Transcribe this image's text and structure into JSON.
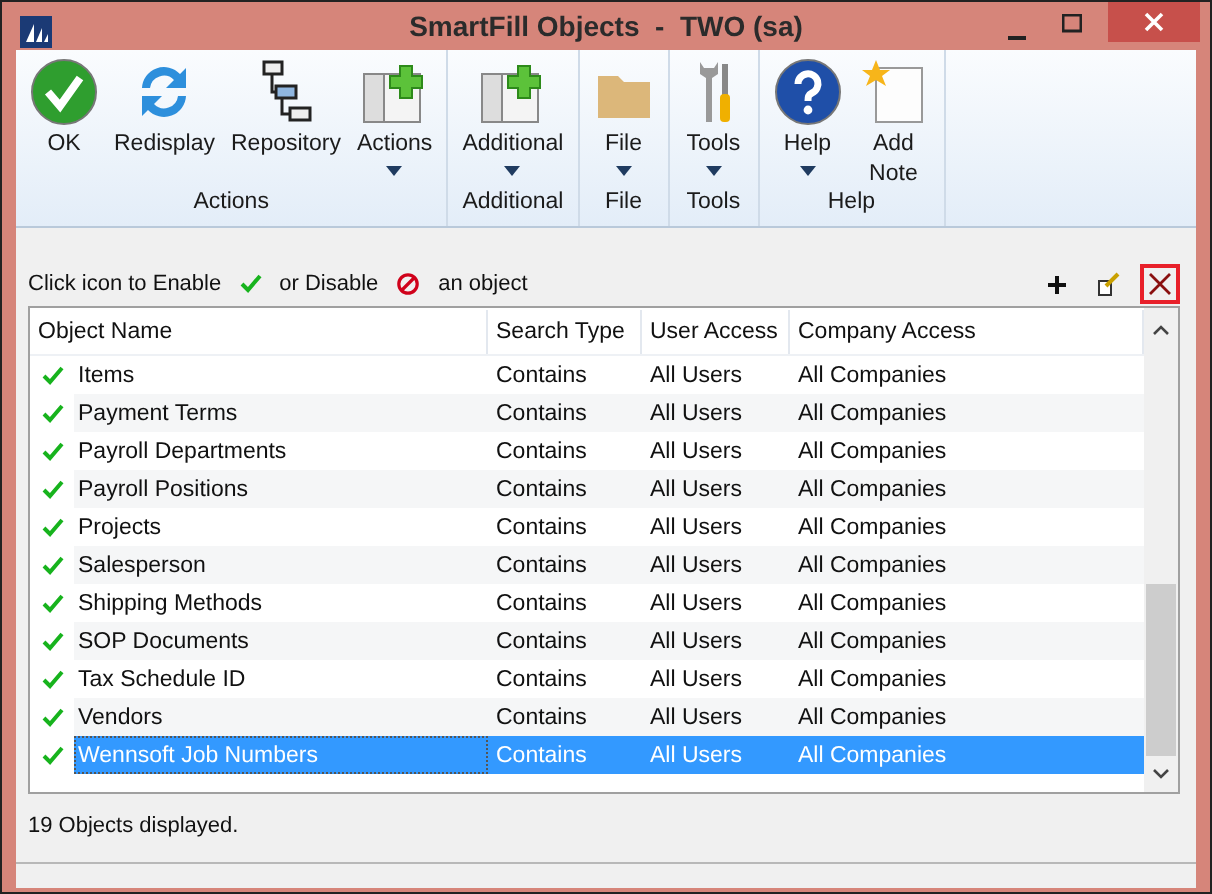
{
  "window": {
    "title": "SmartFill Objects  -  TWO (sa)"
  },
  "ribbon": {
    "groups": [
      {
        "label": "Actions",
        "buttons": [
          {
            "label": "OK",
            "kind": "ok",
            "dropdown": false
          },
          {
            "label": "Redisplay",
            "kind": "refresh",
            "dropdown": false
          },
          {
            "label": "Repository",
            "kind": "tree",
            "dropdown": false
          },
          {
            "label": "Actions",
            "kind": "window",
            "dropdown": true
          }
        ]
      },
      {
        "label": "Additional",
        "buttons": [
          {
            "label": "Additional",
            "kind": "window",
            "dropdown": true
          }
        ]
      },
      {
        "label": "File",
        "buttons": [
          {
            "label": "File",
            "kind": "folder",
            "dropdown": true
          }
        ]
      },
      {
        "label": "Tools",
        "buttons": [
          {
            "label": "Tools",
            "kind": "tools",
            "dropdown": true
          }
        ]
      },
      {
        "label": "Help",
        "buttons": [
          {
            "label": "Help",
            "kind": "help",
            "dropdown": true
          },
          {
            "label": "Add Note",
            "kind": "note",
            "dropdown": false
          }
        ]
      }
    ]
  },
  "hint": {
    "part_1": "Click icon to Enable",
    "part_2": "or Disable",
    "part_3": "an object"
  },
  "tools": [
    {
      "kind": "add",
      "highlighted": false
    },
    {
      "kind": "edit",
      "highlighted": false
    },
    {
      "kind": "delete",
      "highlighted": true
    }
  ],
  "table": {
    "columns": [
      "Object Name",
      "Search Type",
      "User Access",
      "Company Access"
    ],
    "rows": [
      {
        "name": "Items",
        "search_type": "Contains",
        "user_access": "All Users",
        "company_access": "All Companies",
        "enabled": true,
        "selected": false
      },
      {
        "name": "Payment Terms",
        "search_type": "Contains",
        "user_access": "All Users",
        "company_access": "All Companies",
        "enabled": true,
        "selected": false
      },
      {
        "name": "Payroll Departments",
        "search_type": "Contains",
        "user_access": "All Users",
        "company_access": "All Companies",
        "enabled": true,
        "selected": false
      },
      {
        "name": "Payroll Positions",
        "search_type": "Contains",
        "user_access": "All Users",
        "company_access": "All Companies",
        "enabled": true,
        "selected": false
      },
      {
        "name": "Projects",
        "search_type": "Contains",
        "user_access": "All Users",
        "company_access": "All Companies",
        "enabled": true,
        "selected": false
      },
      {
        "name": "Salesperson",
        "search_type": "Contains",
        "user_access": "All Users",
        "company_access": "All Companies",
        "enabled": true,
        "selected": false
      },
      {
        "name": "Shipping Methods",
        "search_type": "Contains",
        "user_access": "All Users",
        "company_access": "All Companies",
        "enabled": true,
        "selected": false
      },
      {
        "name": "SOP Documents",
        "search_type": "Contains",
        "user_access": "All Users",
        "company_access": "All Companies",
        "enabled": true,
        "selected": false
      },
      {
        "name": "Tax Schedule ID",
        "search_type": "Contains",
        "user_access": "All Users",
        "company_access": "All Companies",
        "enabled": true,
        "selected": false
      },
      {
        "name": "Vendors",
        "search_type": "Contains",
        "user_access": "All Users",
        "company_access": "All Companies",
        "enabled": true,
        "selected": false
      },
      {
        "name": "Wennsoft Job Numbers",
        "search_type": "Contains",
        "user_access": "All Users",
        "company_access": "All Companies",
        "enabled": true,
        "selected": true
      }
    ]
  },
  "status_bar": "19 Objects displayed."
}
